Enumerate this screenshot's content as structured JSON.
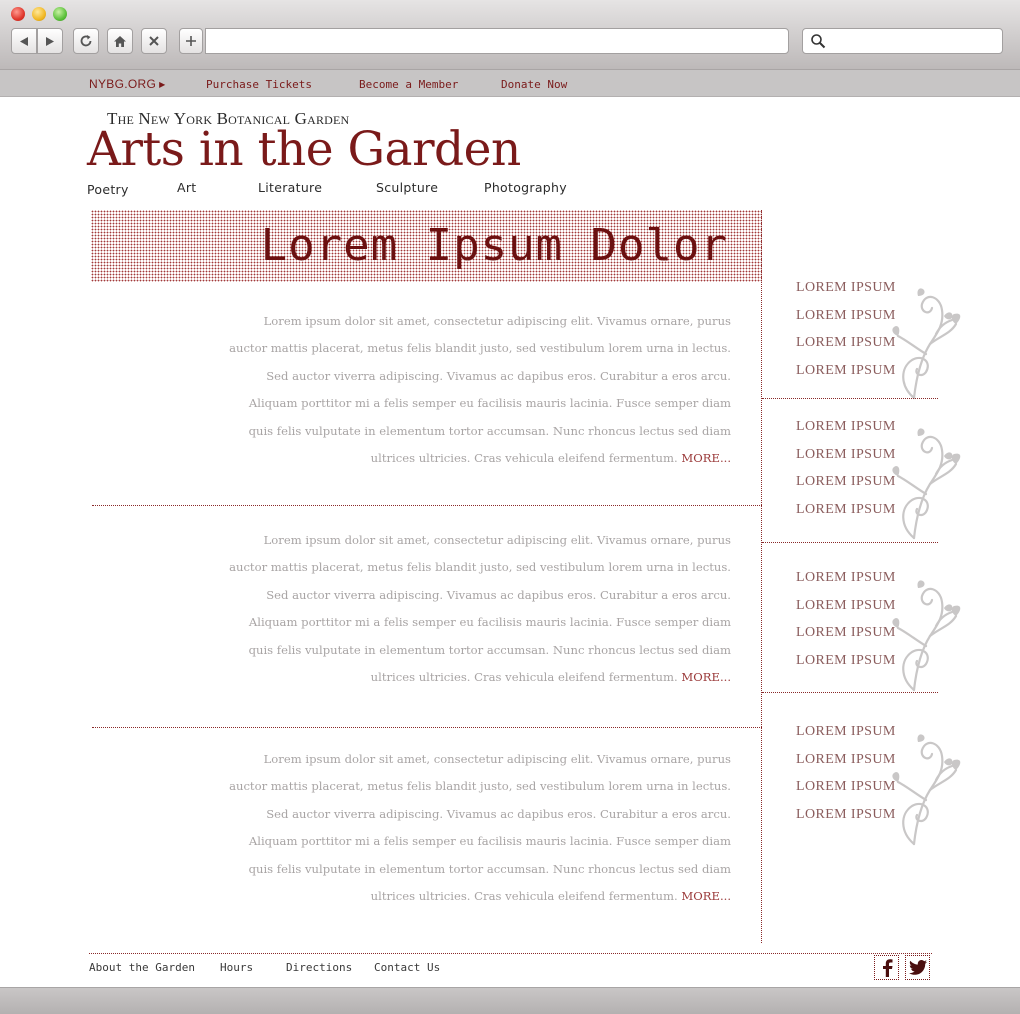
{
  "browser": {
    "address_value": "",
    "search_value": ""
  },
  "utility_nav": {
    "nybg": "NYBG.ORG",
    "tickets": "Purchase Tickets",
    "member": "Become a Member",
    "donate": "Donate Now"
  },
  "header": {
    "org": "The New York Botanical Garden",
    "title": "Arts in the Garden",
    "categories": [
      "Poetry",
      "Art",
      "Literature",
      "Sculpture",
      "Photography"
    ]
  },
  "hero": {
    "title": "Lorem Ipsum Dolor"
  },
  "articles": [
    {
      "body": "Lorem ipsum dolor sit amet, consectetur adipiscing elit. Vivamus ornare, purus auctor mattis placerat, metus felis blandit justo, sed vestibulum lorem urna in lectus. Sed auctor viverra adipiscing. Vivamus ac dapibus eros. Curabitur a eros arcu. Aliquam porttitor mi a felis semper eu facilisis mauris lacinia. Fusce semper diam quis felis vulputate in elementum tortor accumsan. Nunc rhoncus lectus sed diam ultrices ultricies. Cras vehicula eleifend fermentum. ",
      "more": "MORE..."
    },
    {
      "body": "Lorem ipsum dolor sit amet, consectetur adipiscing elit. Vivamus ornare, purus auctor mattis placerat, metus felis blandit justo, sed vestibulum lorem urna in lectus. Sed auctor viverra adipiscing. Vivamus ac dapibus eros. Curabitur a eros arcu. Aliquam porttitor mi a felis semper eu facilisis mauris lacinia. Fusce semper diam quis felis vulputate in elementum tortor accumsan. Nunc rhoncus lectus sed diam ultrices ultricies. Cras vehicula eleifend fermentum. ",
      "more": "MORE..."
    },
    {
      "body": "Lorem ipsum dolor sit amet, consectetur adipiscing elit. Vivamus ornare, purus auctor mattis placerat, metus felis blandit justo, sed vestibulum lorem urna in lectus. Sed auctor viverra adipiscing. Vivamus ac dapibus eros. Curabitur a eros arcu. Aliquam porttitor mi a felis semper eu facilisis mauris lacinia. Fusce semper diam quis felis vulputate in elementum tortor accumsan. Nunc rhoncus lectus sed diam ultrices ultricies. Cras vehicula eleifend fermentum. ",
      "more": "MORE..."
    }
  ],
  "sidebar": {
    "groups": [
      {
        "items": [
          "LOREM IPSUM",
          "LOREM IPSUM",
          "LOREM IPSUM",
          "LOREM IPSUM"
        ]
      },
      {
        "items": [
          "LOREM IPSUM",
          "LOREM IPSUM",
          "LOREM IPSUM",
          "LOREM IPSUM"
        ]
      },
      {
        "items": [
          "LOREM IPSUM",
          "LOREM IPSUM",
          "LOREM IPSUM",
          "LOREM IPSUM"
        ]
      },
      {
        "items": [
          "LOREM IPSUM",
          "LOREM IPSUM",
          "LOREM IPSUM",
          "LOREM IPSUM"
        ]
      }
    ]
  },
  "footer": {
    "links": [
      "About the Garden",
      "Hours",
      "Directions",
      "Contact Us"
    ],
    "social": [
      "facebook-icon",
      "twitter-icon"
    ]
  },
  "colors": {
    "accent": "#7a1a1a",
    "body_text": "#a8a4a4",
    "chrome": "#c7c5c5"
  }
}
